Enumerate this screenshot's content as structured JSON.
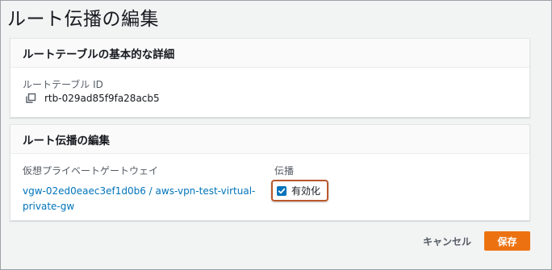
{
  "page": {
    "title": "ルート伝播の編集"
  },
  "details_panel": {
    "header": "ルートテーブルの基本的な詳細",
    "route_table_id_label": "ルートテーブル ID",
    "route_table_id_value": "rtb-029ad85f9fa28acb5",
    "copy_icon": "copy-icon"
  },
  "propagation_panel": {
    "header": "ルート伝播の編集",
    "vgw_column_label": "仮想プライベートゲートウェイ",
    "propagation_column_label": "伝播",
    "vgw_link_text": "vgw-02ed0eaec3ef1d0b6 / aws-vpn-test-virtual-private-gw",
    "enable_checkbox_label": "有効化",
    "enable_checked": true
  },
  "footer": {
    "cancel_label": "キャンセル",
    "save_label": "保存"
  },
  "colors": {
    "accent_orange": "#ec7211",
    "link_blue": "#0073bb",
    "highlight_border": "#b9582b",
    "page_background": "#f2f3f3"
  }
}
